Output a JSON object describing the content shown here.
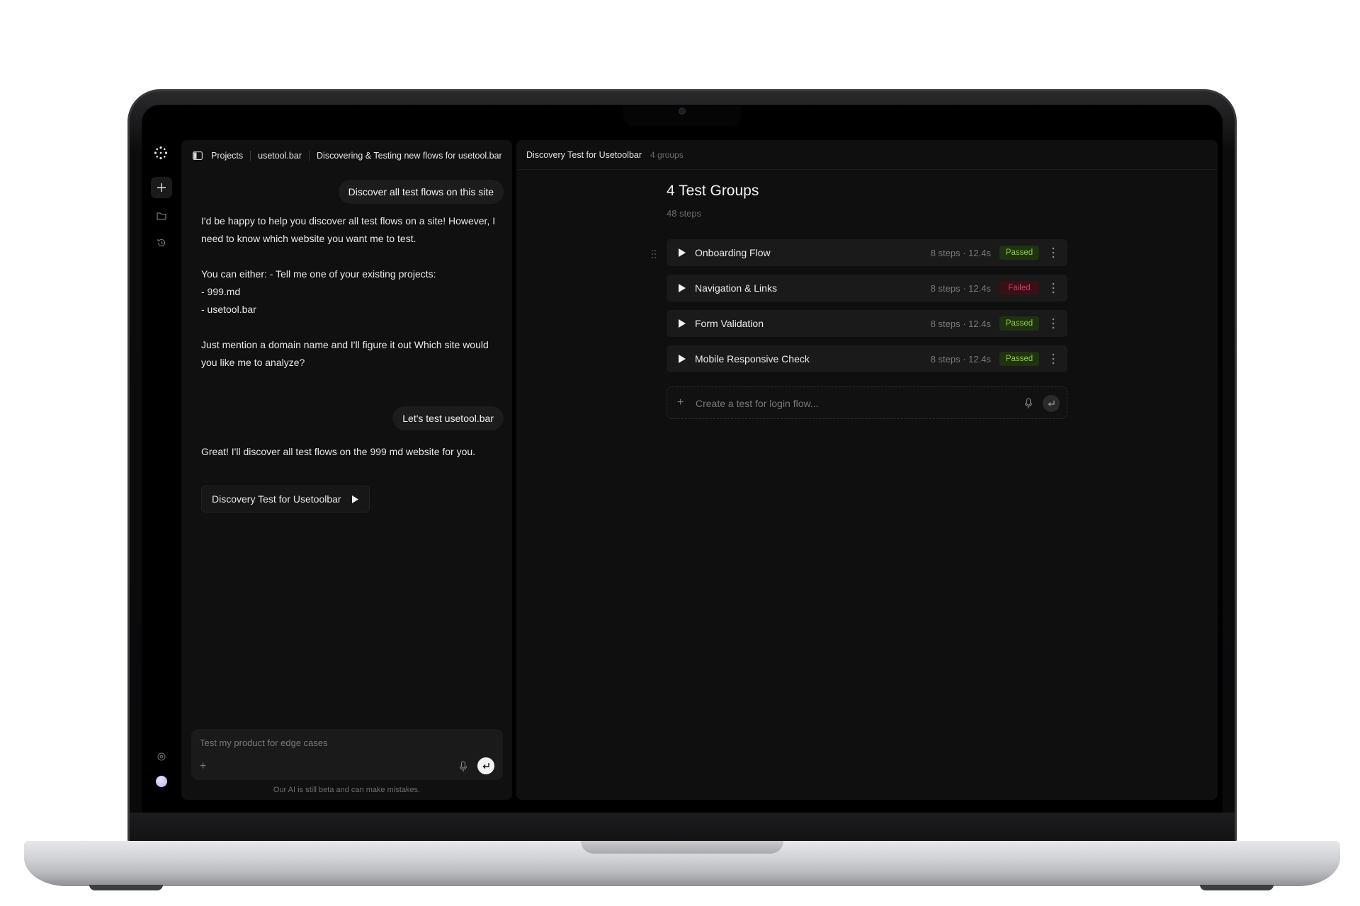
{
  "breadcrumb": {
    "projects": "Projects",
    "project": "usetool.bar",
    "conversation": "Discovering & Testing new flows for usetool.bar"
  },
  "chat": {
    "messages": [
      {
        "role": "user",
        "text": "Discover all test flows on this site"
      },
      {
        "role": "assistant",
        "paragraphs": [
          [
            "I'd be happy to help you discover all test flows on a site! However, I",
            "need to know which website you want me to test."
          ],
          [
            "You can either: - Tell me one of your existing projects:",
            "- 999.md",
            "- usetool.bar"
          ],
          [
            "Just mention a domain name and I'll figure it out Which site would",
            "you like me to analyze?"
          ]
        ]
      },
      {
        "role": "user",
        "text": "Let's test usetool.bar"
      },
      {
        "role": "assistant",
        "paragraphs": [
          [
            "Great! I'll discover all test flows on the 999 md website for you."
          ]
        ]
      }
    ],
    "flow_chip_label": "Discovery Test for Usetoolbar",
    "composer_placeholder": "Test my product for edge cases",
    "disclaimer": "Our AI is still beta and can make mistakes."
  },
  "main": {
    "header_title": "Discovery Test for Usetoolbar",
    "header_count": "4 groups",
    "groups_title": "4 Test Groups",
    "groups_subtitle": "48 steps",
    "groups": [
      {
        "name": "Onboarding Flow",
        "meta": "8 steps · 12.4s",
        "status": "Passed"
      },
      {
        "name": "Navigation & Links",
        "meta": "8 steps · 12.4s",
        "status": "Failed"
      },
      {
        "name": "Form Validation",
        "meta": "8 steps · 12.4s",
        "status": "Passed"
      },
      {
        "name": "Mobile Responsive Check",
        "meta": "8 steps · 12.4s",
        "status": "Passed"
      }
    ],
    "create_placeholder": "Create a test for login flow..."
  },
  "icons": {
    "rail": [
      "logo-icon",
      "plus-icon",
      "folder-icon",
      "history-icon",
      "settings-icon",
      "avatar"
    ],
    "row": [
      "play-icon",
      "kebab-icon"
    ],
    "composer": [
      "plus-icon",
      "mic-icon",
      "send-icon"
    ]
  },
  "colors": {
    "passed": "#8fd13a",
    "failed": "#d33b5a",
    "panel": "#101010",
    "avatar": "#b9b2f5"
  }
}
